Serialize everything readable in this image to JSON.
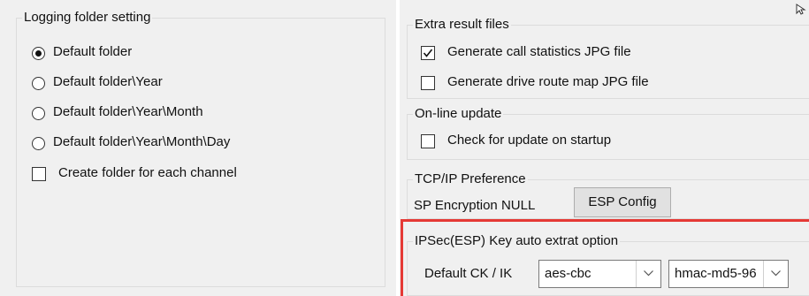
{
  "logging": {
    "title": "Logging folder setting",
    "options": [
      {
        "label": "Default folder",
        "selected": true
      },
      {
        "label": "Default folder\\Year",
        "selected": false
      },
      {
        "label": "Default folder\\Year\\Month",
        "selected": false
      },
      {
        "label": "Default folder\\Year\\Month\\Day",
        "selected": false
      }
    ],
    "per_channel": {
      "label": "Create folder for each channel",
      "checked": false
    }
  },
  "extra": {
    "title": "Extra result files",
    "call_stats": {
      "label": "Generate call statistics JPG file",
      "checked": true
    },
    "drive_route": {
      "label": "Generate drive route map JPG file",
      "checked": false
    }
  },
  "online": {
    "title": "On-line update",
    "check_update": {
      "label": "Check for update on startup",
      "checked": false
    }
  },
  "tcpip": {
    "title": "TCP/IP Preference",
    "encryption_label": "SP Encryption NULL",
    "esp_config_button": "ESP Config"
  },
  "ipsec": {
    "title": "IPSec(ESP) Key auto extrat option",
    "default_label": "Default CK / IK",
    "cipher_value": "aes-cbc",
    "hash_value": "hmac-md5-96"
  },
  "corner_icon": "cursor-icon",
  "colors": {
    "highlight": "#e53935",
    "panel": "#f0f0f0"
  }
}
